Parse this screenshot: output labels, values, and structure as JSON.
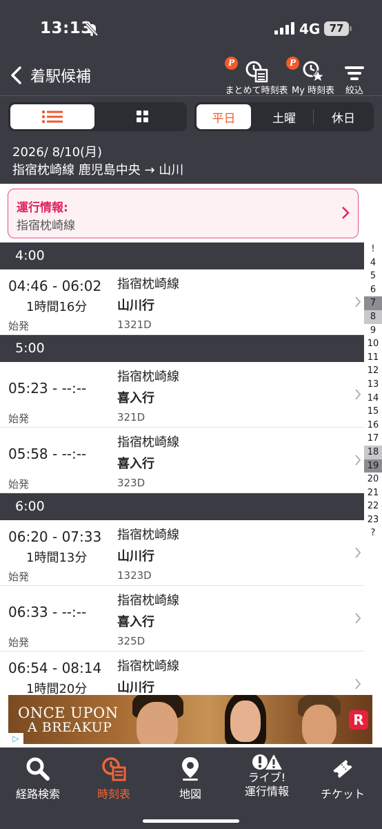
{
  "status_bar": {
    "time": "13:13",
    "network": "4G",
    "battery": "77"
  },
  "header": {
    "title": "着駅候補",
    "buttons": [
      {
        "label": "まとめて時刻表",
        "badge": "P"
      },
      {
        "label": "My 時刻表",
        "badge": "P"
      },
      {
        "label": "絞込"
      }
    ]
  },
  "view_toggle": {
    "options": [
      "list-icon",
      "grid-icon"
    ],
    "selected": 0
  },
  "day_toggle": {
    "options": [
      "平日",
      "土曜",
      "休日"
    ],
    "selected": "平日"
  },
  "query": {
    "date": "2026/ 8/10(月)",
    "route": "指宿枕崎線 鹿児島中央 → 山川"
  },
  "service_info": {
    "title": "運行情報:",
    "line": "指宿枕崎線"
  },
  "timetable": [
    {
      "hour": "4:00",
      "trains": [
        {
          "dep": "04:46 - 06:02",
          "duration": "1時間16分",
          "origin": "始発",
          "line": "指宿枕崎線",
          "dest": "山川行",
          "number": "1321D"
        }
      ]
    },
    {
      "hour": "5:00",
      "trains": [
        {
          "dep": "05:23 - --:--",
          "duration": "",
          "origin": "始発",
          "line": "指宿枕崎線",
          "dest": "喜入行",
          "number": "321D"
        },
        {
          "dep": "05:58 - --:--",
          "duration": "",
          "origin": "始発",
          "line": "指宿枕崎線",
          "dest": "喜入行",
          "number": "323D"
        }
      ]
    },
    {
      "hour": "6:00",
      "trains": [
        {
          "dep": "06:20 - 07:33",
          "duration": "1時間13分",
          "origin": "始発",
          "line": "指宿枕崎線",
          "dest": "山川行",
          "number": "1323D"
        },
        {
          "dep": "06:33 - --:--",
          "duration": "",
          "origin": "始発",
          "line": "指宿枕崎線",
          "dest": "喜入行",
          "number": "325D"
        },
        {
          "dep": "06:54 - 08:14",
          "duration": "1時間20分",
          "origin": "",
          "line": "指宿枕崎線",
          "dest": "山川行",
          "number": ""
        }
      ]
    }
  ],
  "hour_index": [
    "!",
    "4",
    "5",
    "6",
    "7",
    "8",
    "9",
    "10",
    "11",
    "12",
    "13",
    "14",
    "15",
    "16",
    "17",
    "18",
    "19",
    "20",
    "21",
    "22",
    "23",
    "?"
  ],
  "ad": {
    "line1": "ONCE UPON",
    "line2": "A BREAKUP",
    "logo": "R"
  },
  "tabbar": {
    "tabs": [
      {
        "label": "経路検索",
        "icon": "search-icon"
      },
      {
        "label": "時刻表",
        "icon": "timetable-icon",
        "active": true
      },
      {
        "label": "地図",
        "icon": "map-pin-icon"
      },
      {
        "label": "ライブ!\n運行情報",
        "icon": "live-info-icon"
      },
      {
        "label": "チケット",
        "icon": "ticket-icon"
      }
    ],
    "live_label_1": "ライブ!",
    "live_label_2": "運行情報"
  },
  "colors": {
    "accent": "#ee5a2c",
    "header_bg": "#3a3b43",
    "info_border": "#e4517b",
    "info_title": "#e0235e"
  }
}
